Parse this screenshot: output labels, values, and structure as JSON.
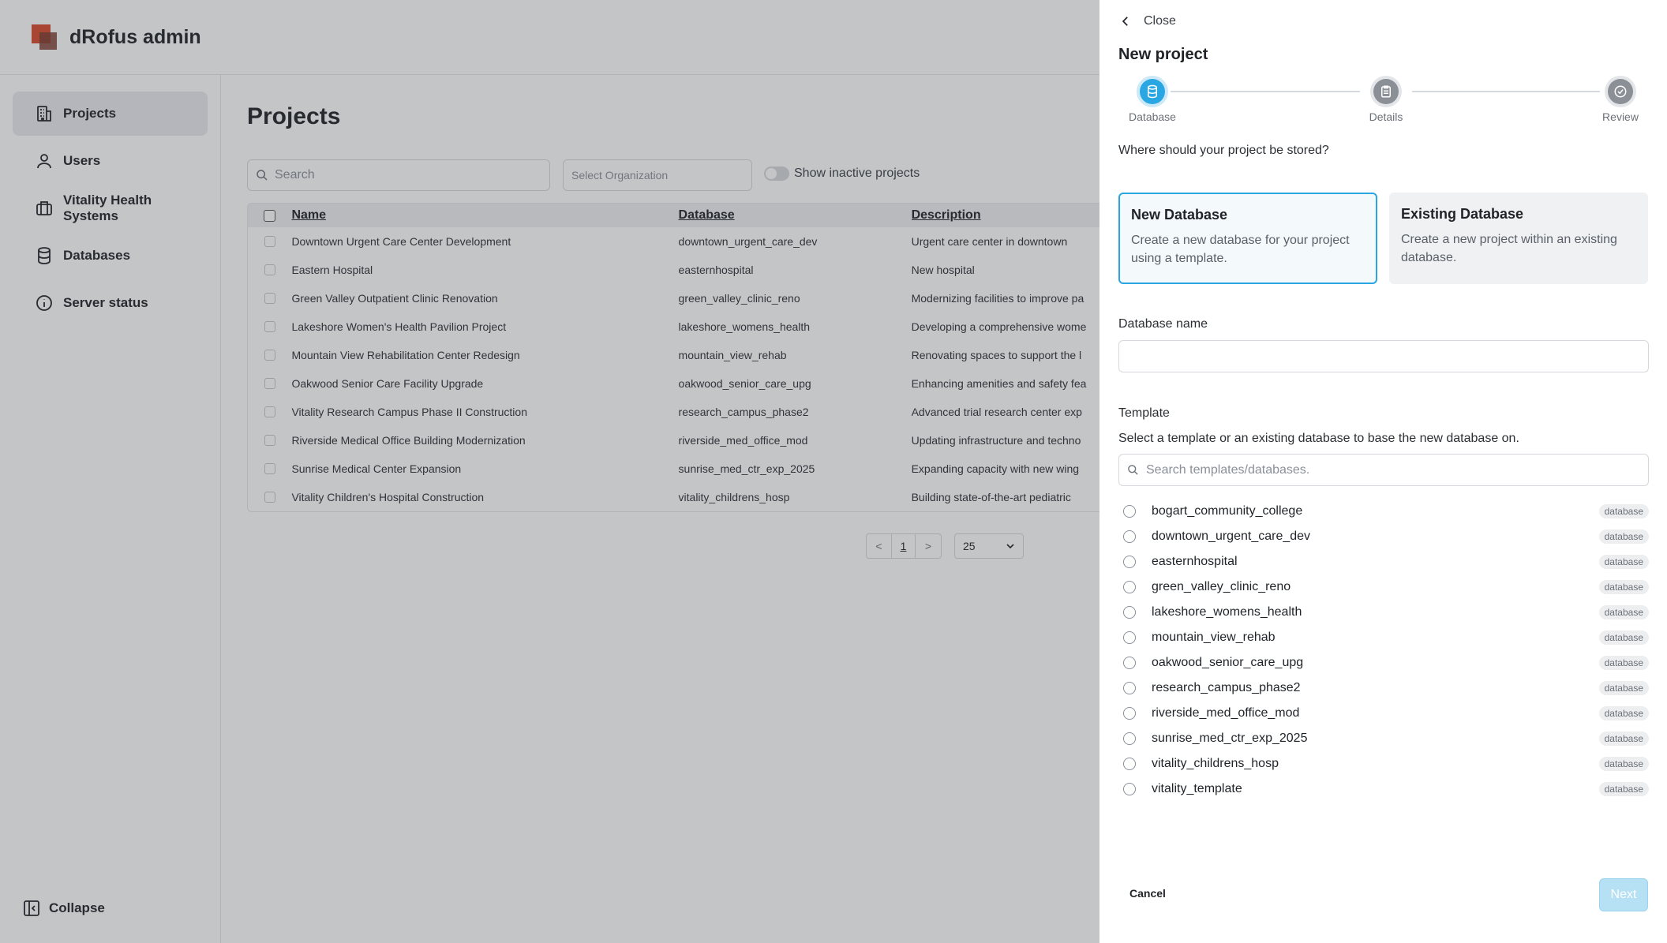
{
  "app": {
    "brand": "dRofus admin"
  },
  "sidebar": {
    "items": [
      {
        "label": "Projects",
        "icon": "building-icon"
      },
      {
        "label": "Users",
        "icon": "user-icon"
      },
      {
        "label": "Vitality Health Systems",
        "icon": "briefcase-icon"
      },
      {
        "label": "Databases",
        "icon": "database-icon"
      },
      {
        "label": "Server status",
        "icon": "info-icon"
      }
    ],
    "collapse_label": "Collapse"
  },
  "main": {
    "title": "Projects",
    "search_placeholder": "Search",
    "org_placeholder": "Select Organization",
    "inactive_label": "Show inactive projects",
    "columns": [
      "Name",
      "Database",
      "Description"
    ],
    "rows": [
      {
        "name": "Downtown Urgent Care Center Development",
        "database": "downtown_urgent_care_dev",
        "description": "Urgent care center in downtown"
      },
      {
        "name": "Eastern Hospital",
        "database": "easternhospital",
        "description": "New hospital"
      },
      {
        "name": "Green Valley Outpatient Clinic Renovation",
        "database": "green_valley_clinic_reno",
        "description": "Modernizing facilities to improve pa"
      },
      {
        "name": "Lakeshore Women's Health Pavilion Project",
        "database": "lakeshore_womens_health",
        "description": "Developing a comprehensive wome"
      },
      {
        "name": "Mountain View Rehabilitation Center Redesign",
        "database": "mountain_view_rehab",
        "description": "Renovating spaces to support the l"
      },
      {
        "name": "Oakwood Senior Care Facility Upgrade",
        "database": "oakwood_senior_care_upg",
        "description": "Enhancing amenities and safety fea"
      },
      {
        "name": "Vitality Research Campus Phase II Construction",
        "database": "research_campus_phase2",
        "description": "Advanced trial research center exp"
      },
      {
        "name": "Riverside Medical Office Building Modernization",
        "database": "riverside_med_office_mod",
        "description": "Updating infrastructure and techno"
      },
      {
        "name": "Sunrise Medical Center Expansion",
        "database": "sunrise_med_ctr_exp_2025",
        "description": "Expanding capacity with new wing"
      },
      {
        "name": "Vitality Children's Hospital Construction",
        "database": "vitality_childrens_hosp",
        "description": "Building state-of-the-art pediatric"
      }
    ],
    "pager": {
      "prev": "<",
      "page": "1",
      "next": ">",
      "page_size": "25"
    }
  },
  "panel": {
    "close_label": "Close",
    "title": "New project",
    "steps": [
      "Database",
      "Details",
      "Review"
    ],
    "question": "Where should your project be stored?",
    "choices": [
      {
        "title": "New Database",
        "desc": "Create a new database for your project using a template."
      },
      {
        "title": "Existing Database",
        "desc": "Create a new project within an existing database."
      }
    ],
    "db_name_label": "Database name",
    "db_name_value": "",
    "template_label": "Template",
    "template_help": "Select a template or an existing database to base the new database on.",
    "template_search_placeholder": "Search templates/databases.",
    "templates": [
      {
        "name": "bogart_community_college",
        "tag": "database"
      },
      {
        "name": "downtown_urgent_care_dev",
        "tag": "database"
      },
      {
        "name": "easternhospital",
        "tag": "database"
      },
      {
        "name": "green_valley_clinic_reno",
        "tag": "database"
      },
      {
        "name": "lakeshore_womens_health",
        "tag": "database"
      },
      {
        "name": "mountain_view_rehab",
        "tag": "database"
      },
      {
        "name": "oakwood_senior_care_upg",
        "tag": "database"
      },
      {
        "name": "research_campus_phase2",
        "tag": "database"
      },
      {
        "name": "riverside_med_office_mod",
        "tag": "database"
      },
      {
        "name": "sunrise_med_ctr_exp_2025",
        "tag": "database"
      },
      {
        "name": "vitality_childrens_hosp",
        "tag": "database"
      },
      {
        "name": "vitality_template",
        "tag": "database"
      }
    ],
    "cancel_label": "Cancel",
    "next_label": "Next"
  },
  "colors": {
    "accent": "#2aa7e3",
    "brand": "#d9482b",
    "disabled_button": "#b6e0f3"
  }
}
